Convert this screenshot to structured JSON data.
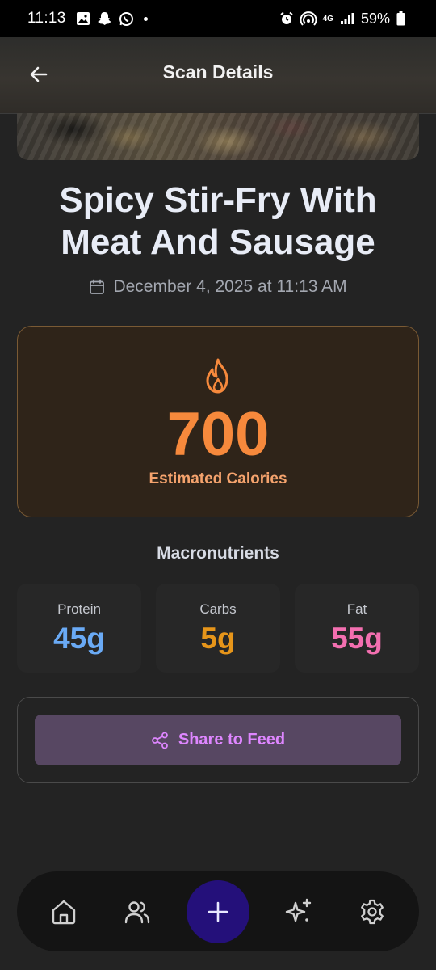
{
  "status_bar": {
    "time": "11:13",
    "battery": "59%",
    "network": "4G"
  },
  "header": {
    "title": "Scan Details"
  },
  "meal": {
    "name": "Spicy Stir-Fry With Meat And Sausage",
    "date": "December 4, 2025 at 11:13 AM"
  },
  "calories": {
    "value": "700",
    "label": "Estimated Calories"
  },
  "macros": {
    "heading": "Macronutrients",
    "items": [
      {
        "label": "Protein",
        "value": "45g",
        "color": "#6aaaf5"
      },
      {
        "label": "Carbs",
        "value": "5g",
        "color": "#e6951a"
      },
      {
        "label": "Fat",
        "value": "55g",
        "color": "#f36fb0"
      }
    ]
  },
  "share": {
    "label": "Share to Feed"
  },
  "nav": {
    "items": [
      "home-icon",
      "users-icon",
      "plus-icon",
      "sparkles-icon",
      "gear-icon"
    ]
  },
  "colors": {
    "accent_orange": "#f6893c",
    "share_text": "#de86ff",
    "add_button": "#24107a"
  }
}
